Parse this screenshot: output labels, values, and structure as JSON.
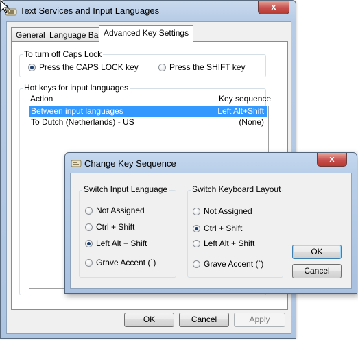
{
  "main_window": {
    "title": "Text Services and Input Languages",
    "close_glyph": "x",
    "tabs": [
      {
        "label": "General"
      },
      {
        "label": "Language Bar"
      },
      {
        "label": "Advanced Key Settings"
      }
    ],
    "caps_lock": {
      "group_label": "To turn off Caps Lock",
      "option_caps": "Press the CAPS LOCK key",
      "option_shift": "Press the SHIFT key",
      "selected": "caps"
    },
    "hotkeys": {
      "group_label": "Hot keys for input languages",
      "col_action": "Action",
      "col_sequence": "Key sequence",
      "rows": [
        {
          "action": "Between input languages",
          "sequence": "Left Alt+Shift",
          "selected": true
        },
        {
          "action": "To Dutch (Netherlands) - US",
          "sequence": "(None)",
          "selected": false
        }
      ]
    },
    "buttons": {
      "ok": "OK",
      "cancel": "Cancel",
      "apply": "Apply"
    }
  },
  "dialog": {
    "title": "Change Key Sequence",
    "close_glyph": "x",
    "input_language": {
      "group_label": "Switch Input Language",
      "options": [
        "Not Assigned",
        "Ctrl + Shift",
        "Left Alt + Shift",
        "Grave Accent (`)"
      ],
      "selected_index": 2
    },
    "keyboard_layout": {
      "group_label": "Switch Keyboard Layout",
      "options": [
        "Not Assigned",
        "Ctrl + Shift",
        "Left Alt + Shift",
        "Grave Accent (`)"
      ],
      "selected_index": 1
    },
    "buttons": {
      "ok": "OK",
      "cancel": "Cancel"
    }
  }
}
